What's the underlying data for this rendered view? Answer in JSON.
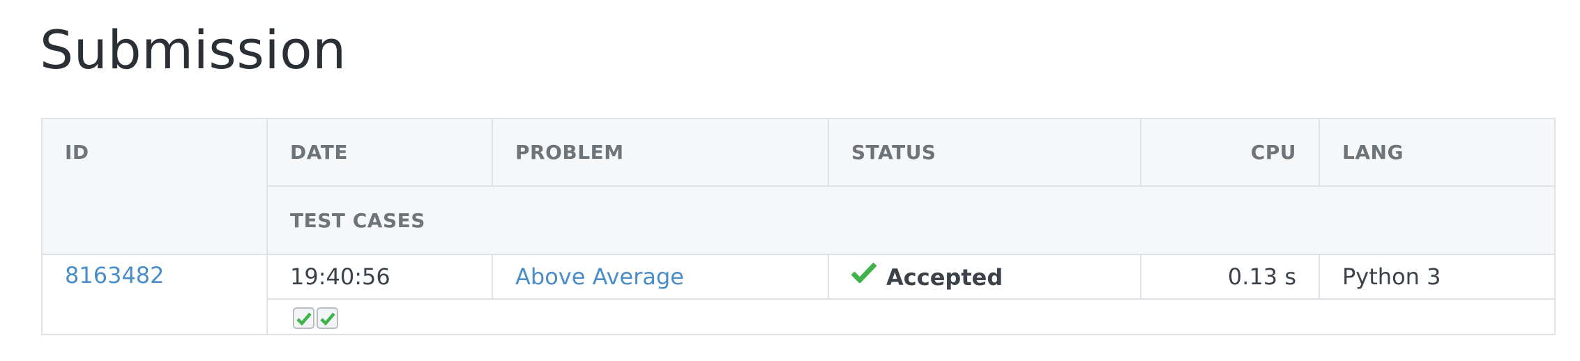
{
  "page": {
    "title": "Submission"
  },
  "table": {
    "headers": {
      "id": "ID",
      "date": "DATE",
      "problem": "PROBLEM",
      "status": "STATUS",
      "cpu": "CPU",
      "lang": "LANG",
      "test_cases": "TEST CASES"
    },
    "row": {
      "id": "8163482",
      "date": "19:40:56",
      "problem": "Above Average",
      "status": "Accepted",
      "status_icon": "check-icon",
      "cpu": "0.13 s",
      "lang": "Python 3",
      "test_cases": [
        {
          "result": "accepted",
          "icon": "check-icon"
        },
        {
          "result": "accepted",
          "icon": "check-icon"
        }
      ]
    }
  },
  "colors": {
    "link": "#4a8dc8",
    "accepted": "#3fb34a",
    "header_bg": "#f6f7f9",
    "border": "#dfe2e6"
  }
}
